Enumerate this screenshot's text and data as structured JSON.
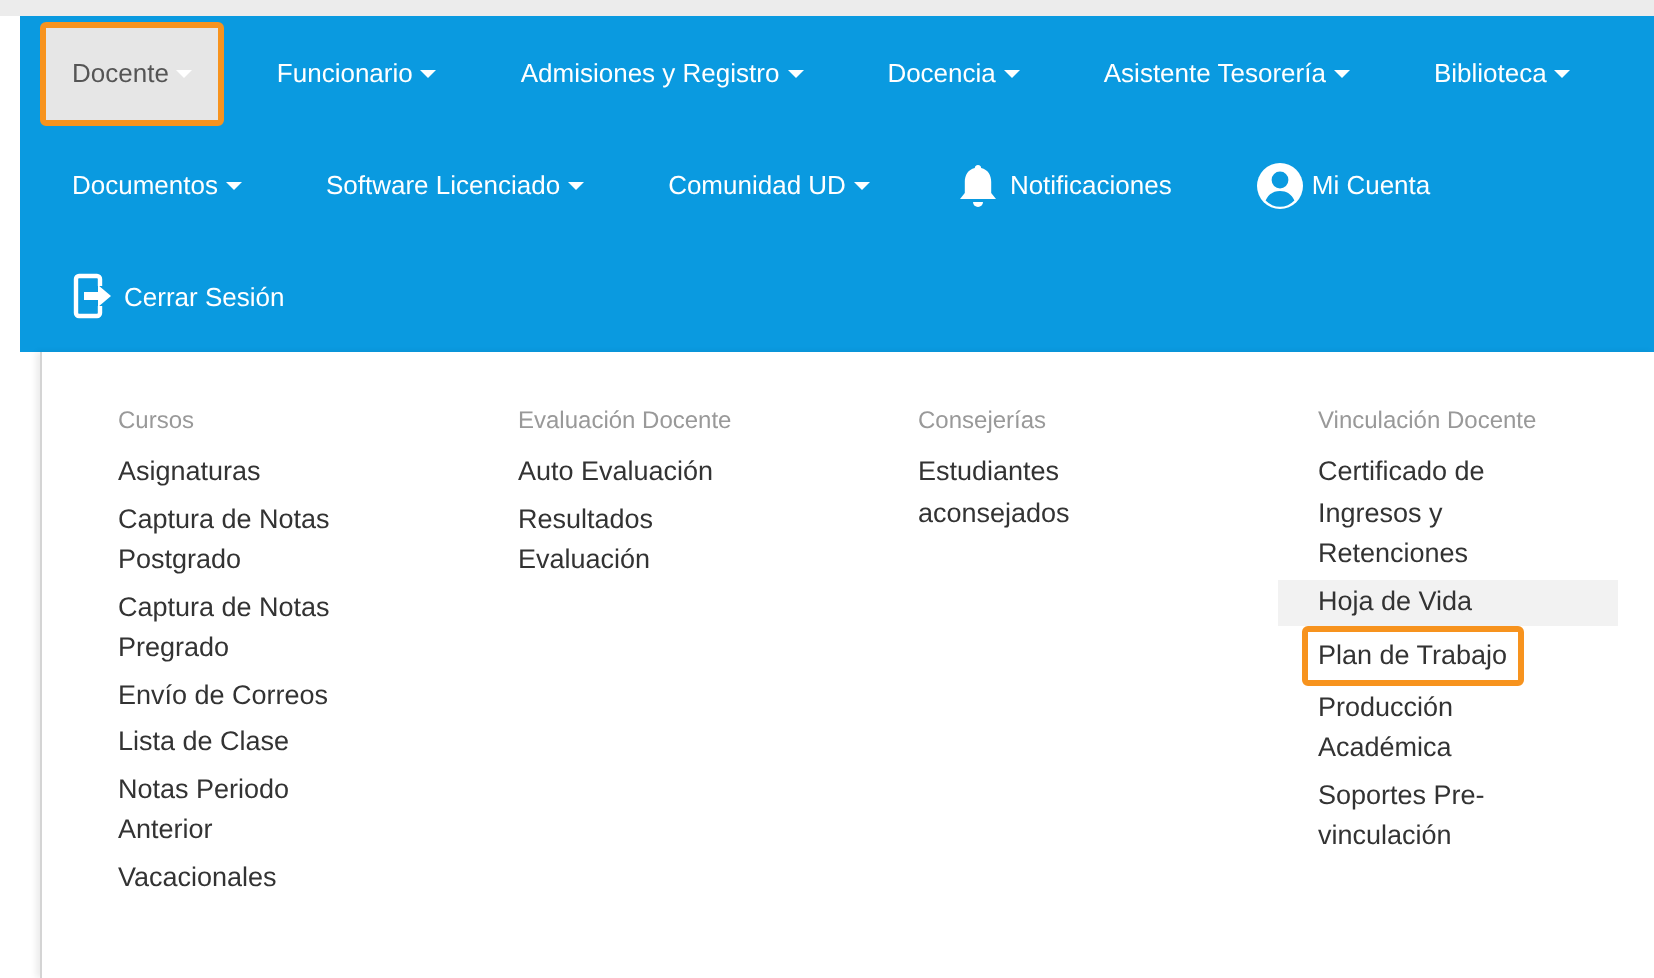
{
  "navbar": {
    "rows": [
      [
        {
          "kind": "dropdown",
          "label": "Docente",
          "selected": true,
          "highlighted": true
        },
        {
          "kind": "dropdown",
          "label": "Funcionario",
          "selected": false,
          "highlighted": false
        },
        {
          "kind": "dropdown",
          "label": "Admisiones y Registro",
          "selected": false,
          "highlighted": false
        },
        {
          "kind": "dropdown",
          "label": "Docencia",
          "selected": false,
          "highlighted": false
        },
        {
          "kind": "dropdown",
          "label": "Asistente Tesorería",
          "selected": false,
          "highlighted": false
        },
        {
          "kind": "dropdown",
          "label": "Biblioteca",
          "selected": false,
          "highlighted": false
        }
      ],
      [
        {
          "kind": "dropdown",
          "label": "Documentos",
          "selected": false,
          "highlighted": false
        },
        {
          "kind": "dropdown",
          "label": "Software Licenciado",
          "selected": false,
          "highlighted": false
        },
        {
          "kind": "dropdown",
          "label": "Comunidad UD",
          "selected": false,
          "highlighted": false
        },
        {
          "kind": "notifications",
          "label": "Notificaciones",
          "selected": false,
          "highlighted": false
        },
        {
          "kind": "account",
          "label": "Mi Cuenta",
          "selected": false,
          "highlighted": false
        }
      ],
      [
        {
          "kind": "logout",
          "label": "Cerrar Sesión",
          "selected": false,
          "highlighted": false
        }
      ]
    ]
  },
  "dropdown": {
    "columns": [
      {
        "header": "Cursos",
        "items": [
          {
            "label": "Asignaturas",
            "hovered": false,
            "highlighted": false
          },
          {
            "label": "Captura de Notas Postgrado",
            "hovered": false,
            "highlighted": false
          },
          {
            "label": "Captura de Notas Pregrado",
            "hovered": false,
            "highlighted": false
          },
          {
            "label": "Envío de Correos",
            "hovered": false,
            "highlighted": false
          },
          {
            "label": "Lista de Clase",
            "hovered": false,
            "highlighted": false
          },
          {
            "label": "Notas Periodo Anterior",
            "hovered": false,
            "highlighted": false
          },
          {
            "label": "Vacacionales",
            "hovered": false,
            "highlighted": false
          }
        ]
      },
      {
        "header": "Evaluación Docente",
        "items": [
          {
            "label": "Auto Evaluación",
            "hovered": false,
            "highlighted": false
          },
          {
            "label": "Resultados Evaluación",
            "hovered": false,
            "highlighted": false
          }
        ]
      },
      {
        "header": "Consejerías",
        "items": [
          {
            "label": "Estudiantes aconsejados",
            "hovered": false,
            "highlighted": false
          }
        ]
      },
      {
        "header": "Vinculación Docente",
        "items": [
          {
            "label": "Certificado de Ingresos y Retenciones",
            "hovered": false,
            "highlighted": false
          },
          {
            "label": "Hoja de Vida",
            "hovered": true,
            "highlighted": false
          },
          {
            "label": "Plan de Trabajo",
            "hovered": false,
            "highlighted": true
          },
          {
            "label": "Producción Académica",
            "hovered": false,
            "highlighted": false
          },
          {
            "label": "Soportes Pre-vinculación",
            "hovered": false,
            "highlighted": false
          }
        ]
      }
    ]
  }
}
